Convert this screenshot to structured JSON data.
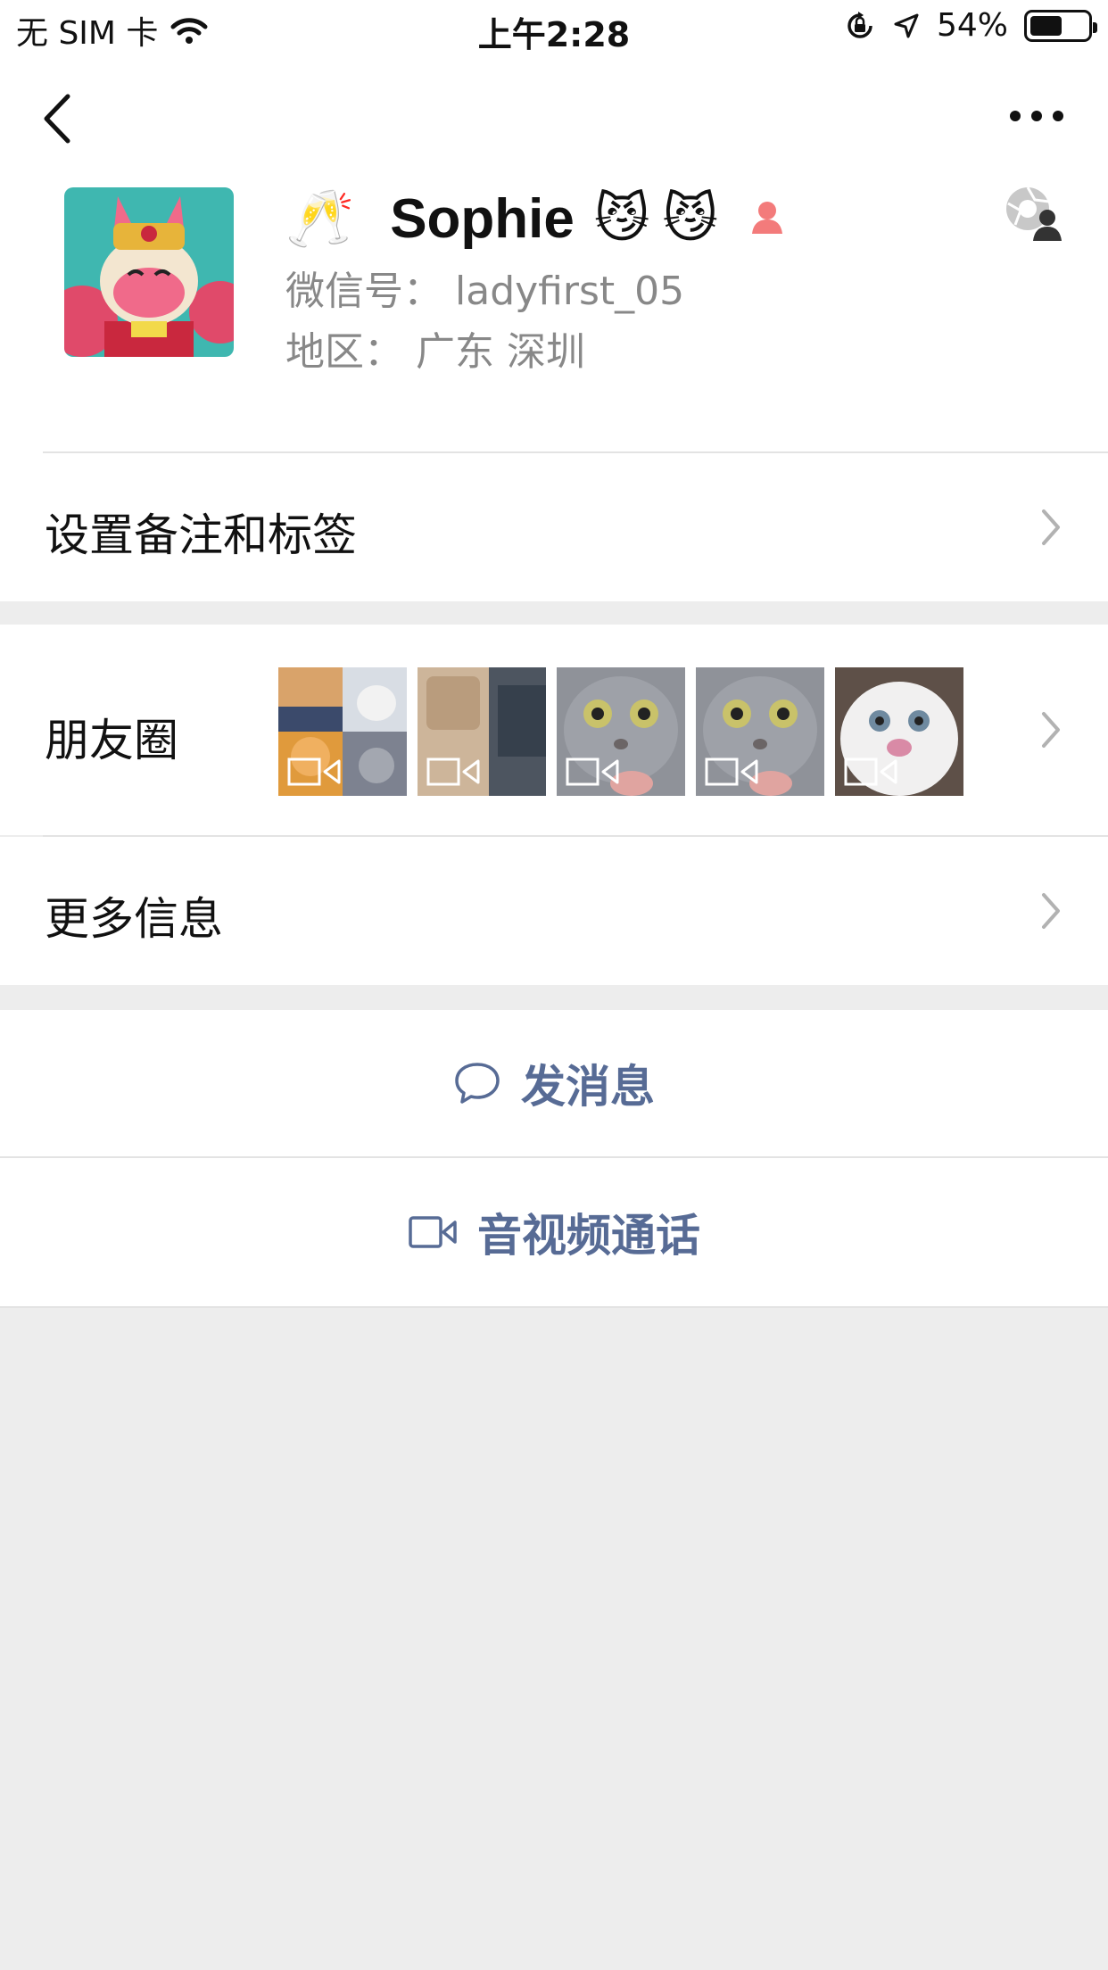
{
  "status_bar": {
    "carrier": "无 SIM 卡",
    "time": "上午2:28",
    "battery_percent_label": "54%",
    "battery_level": 0.54,
    "icons": [
      "wifi-icon",
      "orientation-lock-icon",
      "location-arrow-icon",
      "battery-icon"
    ]
  },
  "nav": {
    "back_icon": "chevron-left-icon",
    "more_icon": "more-dots-icon"
  },
  "profile": {
    "name_prefix_emoji": "🥂",
    "name": "Sophie",
    "name_suffix_emoji_1": "😼",
    "name_suffix_emoji_2": "😼",
    "gender_icon": "female-icon",
    "wechat_id_label": "微信号：",
    "wechat_id_value": "ladyfirst_05",
    "region_label": "地区：",
    "region_value": "广东 深圳"
  },
  "menu": {
    "remark_tags": "设置备注和标签",
    "moments": "朋友圈",
    "more_info": "更多信息"
  },
  "actions": {
    "send_message": "发消息",
    "av_call": "音视频通话"
  },
  "colors": {
    "accent": "#576b95",
    "background": "#ededed",
    "divider": "#e3e3e3",
    "gender_female": "#f37b7b"
  }
}
